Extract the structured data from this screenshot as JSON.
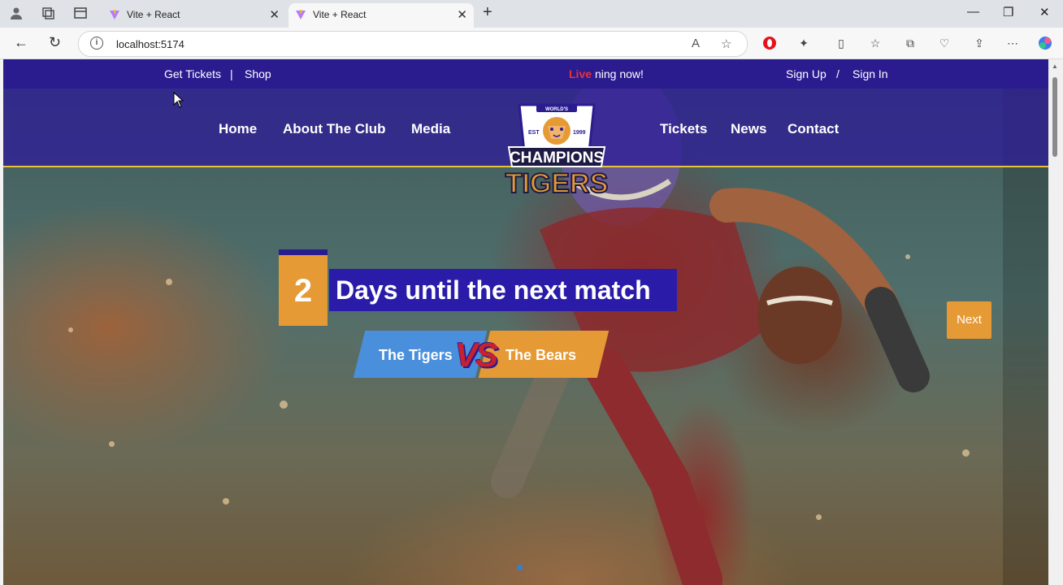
{
  "browser": {
    "tabs": [
      {
        "title": "Vite + React",
        "active": false
      },
      {
        "title": "Vite + React",
        "active": true
      }
    ],
    "address": "localhost:5174",
    "icons": [
      "profile-icon",
      "workspaces-icon",
      "tab-actions-icon",
      "back-icon",
      "refresh-icon",
      "info-icon",
      "read-aloud-icon",
      "favorite-star-icon",
      "opera-icon",
      "extensions-icon",
      "split-screen-icon",
      "favorites-icon",
      "collections-icon",
      "browser-essentials-icon",
      "share-icon",
      "more-icon",
      "copilot-icon"
    ]
  },
  "site": {
    "topbar": {
      "get_tickets": "Get Tickets",
      "divider": "|",
      "shop": "Shop",
      "live": "Live",
      "streaming": "ning now!",
      "sign_up": "Sign Up",
      "slash": "/",
      "sign_in": "Sign In"
    },
    "nav": {
      "home": "Home",
      "about": "About The Club",
      "media": "Media",
      "tickets": "Tickets",
      "news": "News",
      "contact": "Contact"
    },
    "logo": {
      "top": "WORLD'S",
      "est": "EST",
      "year": "1999",
      "line1": "CHAMPIONS",
      "line2": "TIGERS"
    },
    "hero": {
      "days": "2",
      "countdown_text": "Days until the next match",
      "team_left": "The Tigers",
      "vs": "VS",
      "team_right": "The Bears",
      "next": "Next"
    }
  },
  "colors": {
    "navy": "#2a1c8f",
    "orange": "#e59a35",
    "blue": "#4a8fdc",
    "red": "#e8313b"
  }
}
